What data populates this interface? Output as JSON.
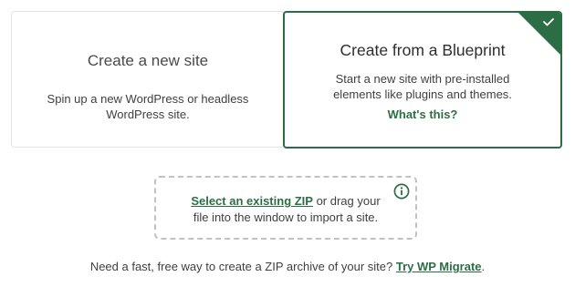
{
  "colors": {
    "accent": "#2b6e45",
    "card_border": "#e3e3e3",
    "dropzone_border": "#c2c2c2"
  },
  "cards": {
    "new_site": {
      "title": "Create a new site",
      "description_line1": "Spin up a new WordPress or headless",
      "description_line2": "WordPress site."
    },
    "blueprint": {
      "title": "Create from a Blueprint",
      "description_line1": "Start a new site with pre-installed",
      "description_line2": "elements like plugins and themes.",
      "link": "What's this?",
      "selected": true,
      "selected_icon": "checkmark-icon"
    }
  },
  "dropzone": {
    "link": "Select an existing ZIP",
    "text_after_link": " or drag your",
    "text_line2": "file into the window to import a site.",
    "icon": "info-icon"
  },
  "footer": {
    "text": "Need a fast, free way to create a ZIP archive of your site? ",
    "link": "Try WP Migrate",
    "suffix": "."
  }
}
